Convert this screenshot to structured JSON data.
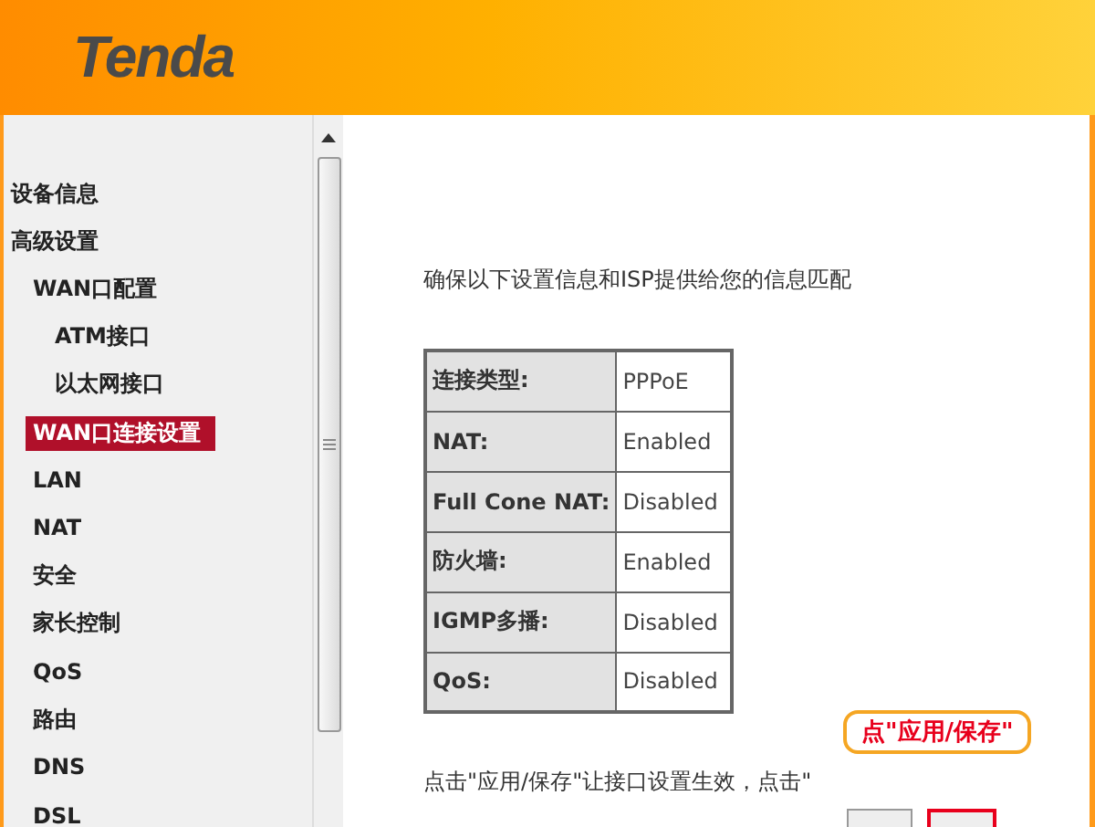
{
  "header": {
    "logo": "Tenda"
  },
  "sidebar": {
    "items": [
      {
        "label": "设备信息",
        "selected": false
      },
      {
        "label": "高级设置",
        "selected": false,
        "children": [
          {
            "label": "WAN口配置",
            "selected": false,
            "children": [
              {
                "label": "ATM接口",
                "selected": false
              },
              {
                "label": "以太网接口",
                "selected": false
              }
            ]
          },
          {
            "label": "WAN口连接设置",
            "selected": true
          },
          {
            "label": "LAN",
            "selected": false
          },
          {
            "label": "NAT",
            "selected": false
          },
          {
            "label": "安全",
            "selected": false
          },
          {
            "label": "家长控制",
            "selected": false
          },
          {
            "label": "QoS",
            "selected": false
          },
          {
            "label": "路由",
            "selected": false
          },
          {
            "label": "DNS",
            "selected": false
          },
          {
            "label": "DSL",
            "selected": false
          }
        ]
      }
    ]
  },
  "main": {
    "intro": "确保以下设置信息和ISP提供给您的信息匹配",
    "summary": [
      {
        "label": "连接类型:",
        "value": "PPPoE"
      },
      {
        "label": "NAT:",
        "value": "Enabled"
      },
      {
        "label": "Full Cone NAT:",
        "value": "Disabled"
      },
      {
        "label": "防火墙:",
        "value": "Enabled"
      },
      {
        "label": "IGMP多播:",
        "value": "Disabled"
      },
      {
        "label": "QoS:",
        "value": "Disabled"
      }
    ],
    "footer_note": "点击\"应用/保存\"让接口设置生效，点击\"",
    "callout": "点\"应用/保存\""
  }
}
